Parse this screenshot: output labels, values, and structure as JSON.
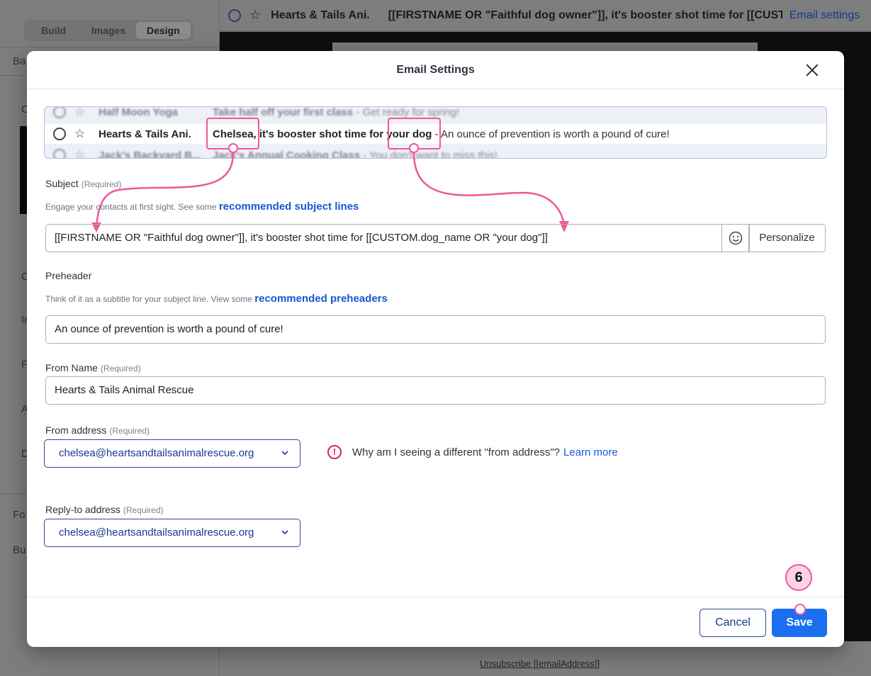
{
  "background": {
    "left_tabs": [
      "Build",
      "Images",
      "Design"
    ],
    "left_panel_rows": [
      "Ba",
      "C",
      "C",
      "Ir",
      "F",
      "A",
      "D",
      "Fo",
      "Bu"
    ],
    "topbar": {
      "sender": "Hearts & Tails Ani.",
      "subject": "[[FIRSTNAME OR \"Faithful dog owner\"]], it's booster shot time for [[CUST…",
      "settings_link": "Email settings"
    },
    "unsubscribe": "Unsubscribe [[emailAddress]]"
  },
  "modal": {
    "title": "Email Settings",
    "inbox_preview": {
      "row_top": {
        "sender": "Half Moon Yoga",
        "subject": "Take half off your first class",
        "preheader": "- Get ready for spring!"
      },
      "row_main": {
        "sender": "Hearts & Tails Ani.",
        "subject_name": "Chelsea,",
        "subject_mid": " it's booster shot time for ",
        "subject_dog": "your dog",
        "preheader": " - An ounce of prevention is worth a pound of cure!"
      },
      "row_bottom": {
        "sender": "Jack's Backyard B...",
        "subject": "Jack's Annual Cooking Class",
        "preheader": "- You don't want to miss this!"
      }
    },
    "subject": {
      "label": "Subject",
      "required": "(Required)",
      "help": "Engage your contacts at first sight. See some",
      "help_link": "recommended subject lines",
      "value": "[[FIRSTNAME OR \"Faithful dog owner\"]], it's booster shot time for   [[CUSTOM.dog_name OR \"your dog\"]]",
      "personalize": "Personalize"
    },
    "preheader": {
      "label": "Preheader",
      "help": "Think of it as a subtitle for your subject line. View some",
      "help_link": "recommended preheaders",
      "value": "An ounce of prevention is worth a pound of cure!"
    },
    "from_name": {
      "label": "From Name",
      "required": "(Required)",
      "value": "Hearts & Tails Animal Rescue"
    },
    "from_address": {
      "label": "From address",
      "required": "(Required)",
      "value": "chelsea@heartsandtailsanimalrescue.org",
      "info_text": "Why am I seeing a different \"from address\"?",
      "info_link": "Learn more"
    },
    "reply_to": {
      "label": "Reply-to address",
      "required": "(Required)",
      "value": "chelsea@heartsandtailsanimalrescue.org"
    },
    "footer": {
      "cancel": "Cancel",
      "save": "Save"
    },
    "step_number": "6"
  },
  "colors": {
    "accent": "#1a6ff0",
    "annotation": "#f0569c",
    "link": "#1558d6"
  }
}
